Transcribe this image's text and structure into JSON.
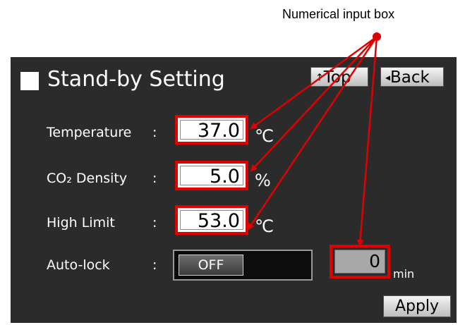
{
  "callout": "Numerical input box",
  "header": {
    "title": "Stand-by Setting",
    "top_label": "Top",
    "back_label": "Back"
  },
  "rows": [
    {
      "label": "Temperature",
      "colon": ":",
      "value": "37.0",
      "unit": "℃"
    },
    {
      "label": "CO₂ Density",
      "colon": ":",
      "value": "5.0",
      "unit": "%"
    },
    {
      "label": "High Limit",
      "colon": ":",
      "value": "53.0",
      "unit": "℃"
    }
  ],
  "autolock": {
    "label": "Auto-lock",
    "colon": ":",
    "state": "OFF",
    "minutes": "0",
    "unit": "min"
  },
  "apply_label": "Apply",
  "colors": {
    "screen": "#2b2b2b",
    "highlight": "#e00000"
  }
}
